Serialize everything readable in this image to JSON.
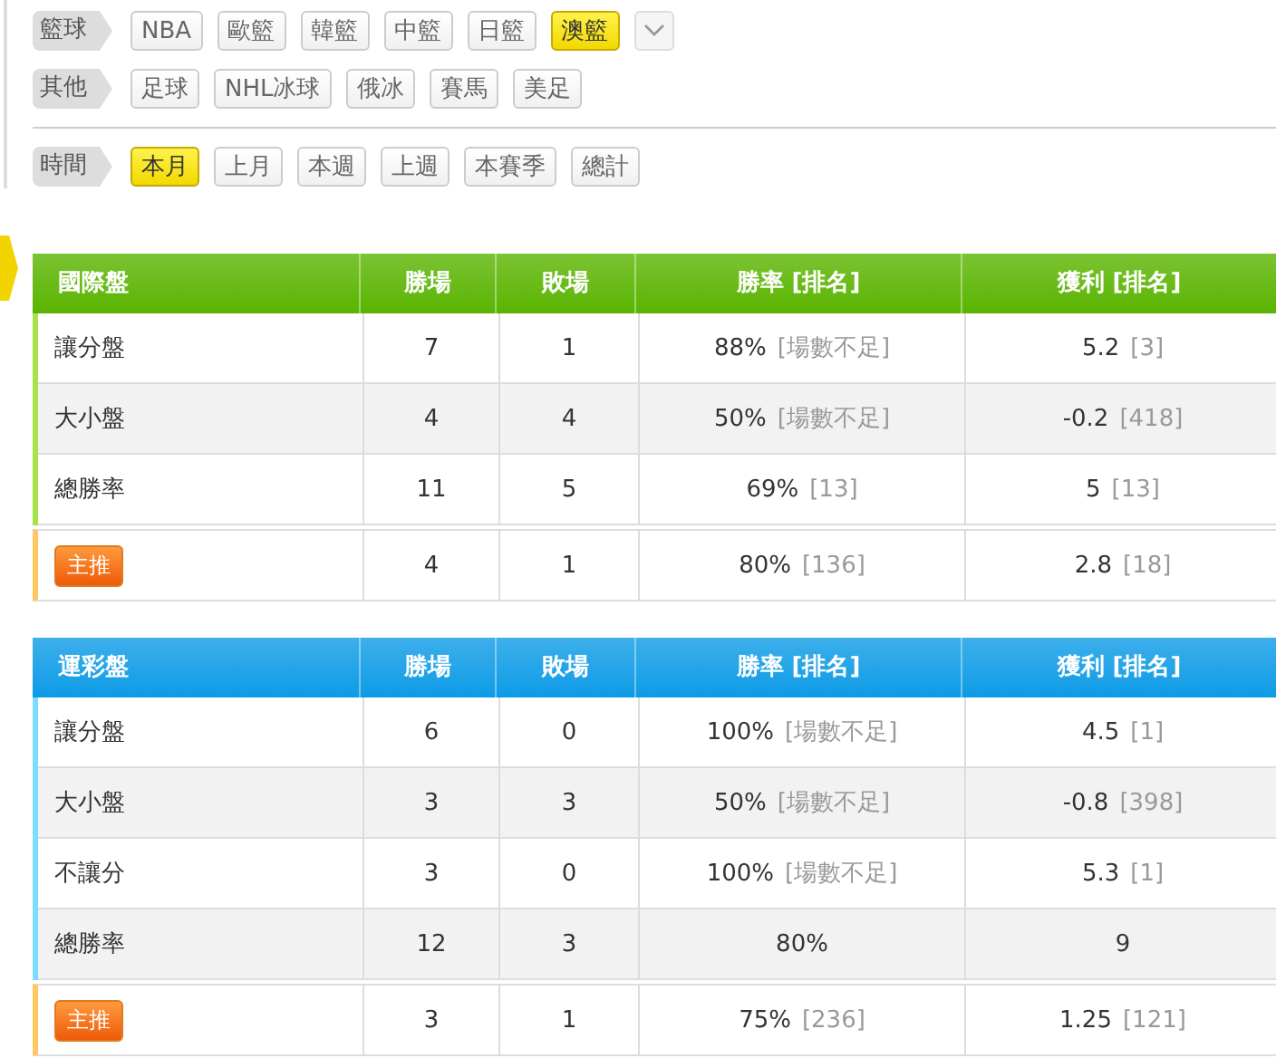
{
  "filter_groups": [
    {
      "label": "籃球",
      "separator_before": false,
      "more_button": true,
      "options": [
        {
          "text": "NBA",
          "selected": false
        },
        {
          "text": "歐籃",
          "selected": false
        },
        {
          "text": "韓籃",
          "selected": false
        },
        {
          "text": "中籃",
          "selected": false
        },
        {
          "text": "日籃",
          "selected": false
        },
        {
          "text": "澳籃",
          "selected": true
        }
      ]
    },
    {
      "label": "其他",
      "separator_before": false,
      "more_button": false,
      "options": [
        {
          "text": "足球",
          "selected": false
        },
        {
          "text": "NHL冰球",
          "selected": false
        },
        {
          "text": "俄冰",
          "selected": false
        },
        {
          "text": "賽馬",
          "selected": false
        },
        {
          "text": "美足",
          "selected": false
        }
      ]
    },
    {
      "label": "時間",
      "separator_before": true,
      "more_button": false,
      "options": [
        {
          "text": "本月",
          "selected": true
        },
        {
          "text": "上月",
          "selected": false
        },
        {
          "text": "本週",
          "selected": false
        },
        {
          "text": "上週",
          "selected": false
        },
        {
          "text": "本賽季",
          "selected": false
        },
        {
          "text": "總計",
          "selected": false
        }
      ]
    }
  ],
  "tables": [
    {
      "color": "#5ab400",
      "columns": [
        "國際盤",
        "勝場",
        "敗場",
        "勝率 [排名]",
        "獲利 [排名]"
      ],
      "rows": [
        {
          "kind": "normal",
          "label": "讓分盤",
          "wins": "7",
          "losses": "1",
          "rate": "88%",
          "rate_rank": "[場數不足]",
          "profit": "5.2",
          "profit_rank": "[3]"
        },
        {
          "kind": "normal",
          "label": "大小盤",
          "wins": "4",
          "losses": "4",
          "rate": "50%",
          "rate_rank": "[場數不足]",
          "profit": "-0.2",
          "profit_rank": "[418]"
        },
        {
          "kind": "normal",
          "label": "總勝率",
          "wins": "11",
          "losses": "5",
          "rate": "69%",
          "rate_rank": "[13]",
          "profit": "5",
          "profit_rank": "[13]"
        },
        {
          "kind": "featured",
          "label": "主推",
          "wins": "4",
          "losses": "1",
          "rate": "80%",
          "rate_rank": "[136]",
          "profit": "2.8",
          "profit_rank": "[18]"
        }
      ]
    },
    {
      "color": "#0d9be6",
      "columns": [
        "運彩盤",
        "勝場",
        "敗場",
        "勝率 [排名]",
        "獲利 [排名]"
      ],
      "rows": [
        {
          "kind": "normal",
          "label": "讓分盤",
          "wins": "6",
          "losses": "0",
          "rate": "100%",
          "rate_rank": "[場數不足]",
          "profit": "4.5",
          "profit_rank": "[1]"
        },
        {
          "kind": "normal",
          "label": "大小盤",
          "wins": "3",
          "losses": "3",
          "rate": "50%",
          "rate_rank": "[場數不足]",
          "profit": "-0.8",
          "profit_rank": "[398]"
        },
        {
          "kind": "normal",
          "label": "不讓分",
          "wins": "3",
          "losses": "0",
          "rate": "100%",
          "rate_rank": "[場數不足]",
          "profit": "5.3",
          "profit_rank": "[1]"
        },
        {
          "kind": "normal",
          "label": "總勝率",
          "wins": "12",
          "losses": "3",
          "rate": "80%",
          "profit": "9"
        },
        {
          "kind": "featured",
          "label": "主推",
          "wins": "3",
          "losses": "1",
          "rate": "75%",
          "rate_rank": "[236]",
          "profit": "1.25",
          "profit_rank": "[121]"
        }
      ]
    }
  ]
}
